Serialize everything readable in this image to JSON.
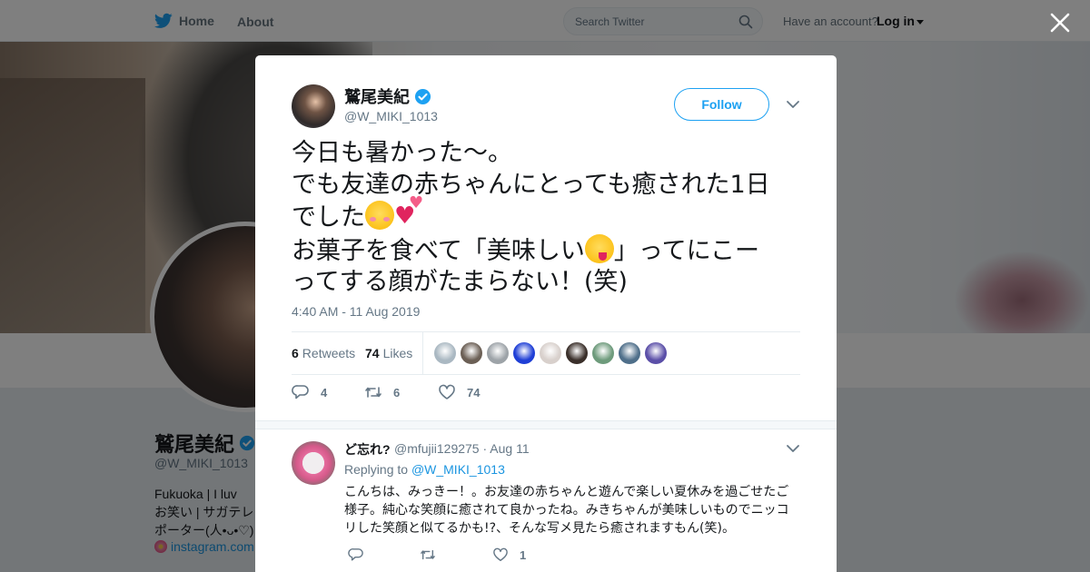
{
  "nav": {
    "home_label": "Home",
    "about_label": "About",
    "search_placeholder": "Search Twitter",
    "account_prompt": "Have an account?",
    "login_label": "Log in"
  },
  "profile": {
    "name": "鷲尾美紀",
    "handle": "@W_MIKI_1013",
    "bio_lines": [
      "Fukuoka | I luv",
      "お笑い | サガテレ",
      "ポーター(人•ᴗ•♡)"
    ],
    "link_text": "instagram.com"
  },
  "tweet": {
    "author_name": "鷲尾美紀",
    "author_handle": "@W_MIKI_1013",
    "follow_label": "Follow",
    "text_lines": [
      "今日も暑かった〜。",
      "でも友達の赤ちゃんにとっても癒された1日",
      "でした",
      "お菓子を食べて「美味しい",
      "」ってにこー",
      "ってする顔がたまらない！(笑)"
    ],
    "timestamp": "4:40 AM - 11 Aug 2019",
    "retweet_count": "6",
    "retweet_label": "Retweets",
    "like_count": "74",
    "like_label": "Likes",
    "reply_action_count": "4",
    "retweet_action_count": "6",
    "like_action_count": "74",
    "likers": [
      {
        "icon": "default-avatar",
        "color": "#aab8c2"
      },
      {
        "icon": "user-avatar",
        "color": "#6b5f55"
      },
      {
        "icon": "user-avatar",
        "color": "#9da3a8"
      },
      {
        "icon": "user-avatar",
        "color": "#1f3fd6"
      },
      {
        "icon": "user-avatar",
        "color": "#d8d0cc"
      },
      {
        "icon": "user-avatar",
        "color": "#3a2f2a"
      },
      {
        "icon": "user-avatar",
        "color": "#6e9b7c"
      },
      {
        "icon": "user-avatar",
        "color": "#4f6f8a"
      },
      {
        "icon": "user-avatar",
        "color": "#5b4fa8"
      }
    ]
  },
  "reply": {
    "name": "ど忘れ?",
    "handle_date": "@mfujii129275 · Aug 11",
    "replying_prefix": "Replying to",
    "replying_to": "@W_MIKI_1013",
    "text": "こんちは、みっきー！。お友達の赤ちゃんと遊んで楽しい夏休みを過ごせたご様子。純心な笑顔に癒されて良かったね。みきちゃんが美味しいものでニッコリした笑顔と似てるかも!?、そんな写メ見たら癒されますもん(笑)。",
    "like_count": "1"
  },
  "colors": {
    "brand": "#1da1f2",
    "link": "#1b95e0",
    "verified": "#1da1f2",
    "muted_text": "#657786"
  }
}
